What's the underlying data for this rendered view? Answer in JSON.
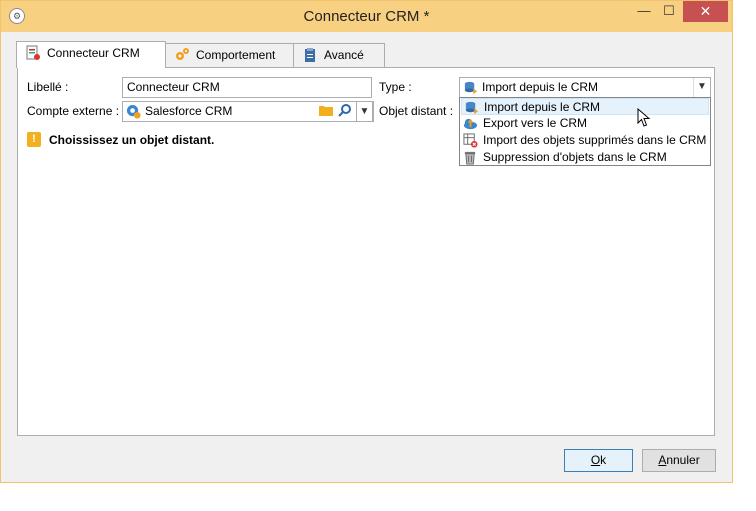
{
  "window": {
    "title": "Connecteur CRM *",
    "controls": {
      "minimize": "—",
      "maximize": "☐",
      "close": "✕"
    }
  },
  "tabs": [
    {
      "label": "Connecteur CRM",
      "icon": "crm-connector-icon",
      "active": true
    },
    {
      "label": "Comportement",
      "icon": "gears-icon",
      "active": false
    },
    {
      "label": "Avancé",
      "icon": "clipboard-icon",
      "active": false
    }
  ],
  "form": {
    "libelle_label": "Libellé :",
    "libelle_value": "Connecteur CRM",
    "type_label": "Type :",
    "type_value": "Import depuis le CRM",
    "compte_label": "Compte externe :",
    "compte_value": "Salesforce CRM",
    "objet_label": "Objet distant :",
    "warning": "Choississez un objet distant."
  },
  "type_options": [
    {
      "label": "Import depuis le CRM",
      "icon": "import-db-icon",
      "selected": true
    },
    {
      "label": "Export vers le CRM",
      "icon": "export-cloud-icon",
      "selected": false
    },
    {
      "label": "Import des objets supprimés dans le CRM",
      "icon": "deleted-objects-icon",
      "selected": false
    },
    {
      "label": "Suppression d'objets dans le CRM",
      "icon": "trash-icon",
      "selected": false
    }
  ],
  "buttons": {
    "ok": {
      "mnemonic": "O",
      "rest": "k"
    },
    "cancel": {
      "mnemonic": "A",
      "rest": "nnuler"
    }
  },
  "colors": {
    "titlebar": "#f8d082",
    "close": "#c75050",
    "selection": "#e5f1fb",
    "warning": "#f2b01e"
  }
}
